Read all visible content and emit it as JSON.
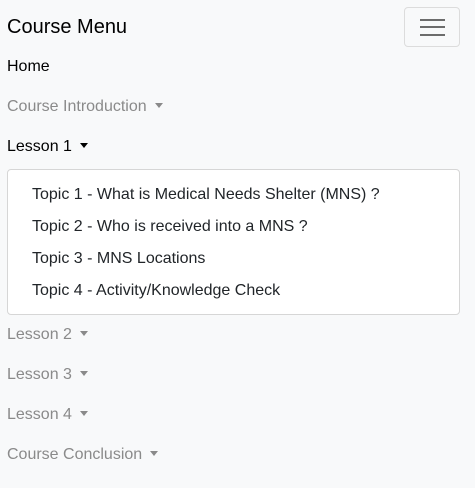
{
  "navbar": {
    "brand": "Course Menu",
    "toggler_icon": "hamburger-menu-icon"
  },
  "menu": {
    "home": "Home",
    "course_introduction": "Course Introduction",
    "lesson1": "Lesson 1",
    "lesson1_topics": [
      "Topic 1 - What is Medical Needs Shelter (MNS) ?",
      "Topic 2 - Who is received into a MNS ?",
      "Topic 3 - MNS Locations",
      "Topic 4 - Activity/Knowledge Check"
    ],
    "lesson2": "Lesson 2",
    "lesson3": "Lesson 3",
    "lesson4": "Lesson 4",
    "course_conclusion": "Course Conclusion"
  },
  "colors": {
    "background": "#f8f9fa",
    "active_text": "#000000",
    "muted_text": "#8a8a8a"
  }
}
